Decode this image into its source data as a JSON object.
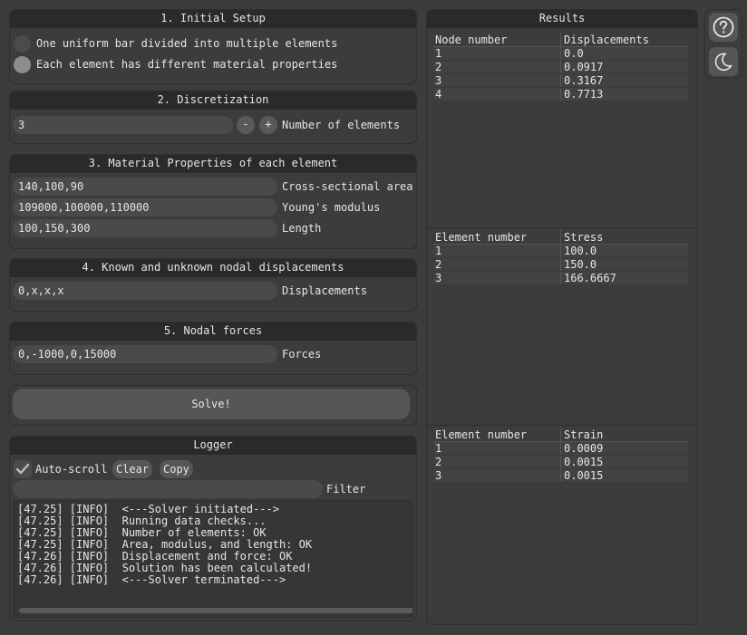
{
  "setup": {
    "title": "1. Initial Setup",
    "option1": "One uniform bar divided into multiple elements",
    "option2": "Each element has different material properties"
  },
  "discretization": {
    "title": "2. Discretization",
    "value": "3",
    "minus": "-",
    "plus": "+",
    "label": "Number of elements"
  },
  "material": {
    "title": "3. Material Properties of each element",
    "area_value": "140,100,90",
    "area_label": "Cross-sectional area",
    "modulus_value": "109000,100000,110000",
    "modulus_label": "Young's modulus",
    "length_value": "100,150,300",
    "length_label": "Length"
  },
  "displacements": {
    "title": "4. Known and unknown nodal displacements",
    "value": "0,x,x,x",
    "label": "Displacements"
  },
  "forces": {
    "title": "5. Nodal forces",
    "value": "0,-1000,0,15000",
    "label": "Forces"
  },
  "solve_label": "Solve!",
  "logger": {
    "title": "Logger",
    "autoscroll": "Auto-scroll",
    "clear": "Clear",
    "copy": "Copy",
    "filter_label": "Filter",
    "lines": [
      "[47.25] [INFO]  <---Solver initiated--->",
      "[47.25] [INFO]  Running data checks...",
      "[47.25] [INFO]  Number of elements: OK",
      "[47.25] [INFO]  Area, modulus, and length: OK",
      "[47.26] [INFO]  Displacement and force: OK",
      "[47.26] [INFO]  Solution has been calculated!",
      "[47.26] [INFO]  <---Solver terminated--->"
    ]
  },
  "results": {
    "title": "Results",
    "displacements": {
      "headers": [
        "Node number",
        "Displacements"
      ],
      "rows": [
        [
          "1",
          "0.0"
        ],
        [
          "2",
          "0.0917"
        ],
        [
          "3",
          "0.3167"
        ],
        [
          "4",
          "0.7713"
        ]
      ]
    },
    "stress": {
      "headers": [
        "Element number",
        "Stress"
      ],
      "rows": [
        [
          "1",
          "100.0"
        ],
        [
          "2",
          "150.0"
        ],
        [
          "3",
          "166.6667"
        ]
      ]
    },
    "strain": {
      "headers": [
        "Element number",
        "Strain"
      ],
      "rows": [
        [
          "1",
          "0.0009"
        ],
        [
          "2",
          "0.0015"
        ],
        [
          "3",
          "0.0015"
        ]
      ]
    }
  },
  "sidebar": {
    "help_icon": "question-mark-icon",
    "theme_icon": "moon-icon"
  }
}
